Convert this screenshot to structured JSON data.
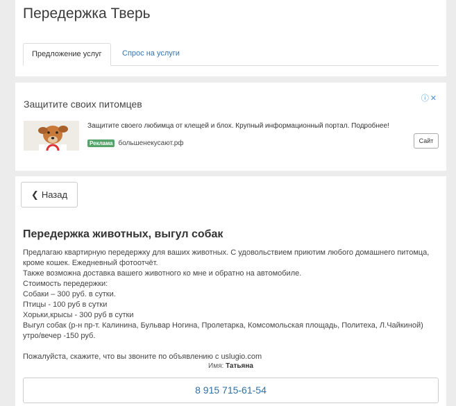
{
  "header": {
    "title": "Передержка Тверь",
    "tabs": [
      {
        "label": "Предложение услуг"
      },
      {
        "label": "Спрос на услуги"
      }
    ]
  },
  "ad": {
    "title": "Защитите своих питомцев",
    "text": "Защитите своего любимца от клещей и блох. Крупный информационный портал. Подробнее!",
    "badge": "Реклама",
    "domain": "большенекусают.рф",
    "button": "Сайт",
    "icons": [
      "info-icon",
      "close-icon"
    ]
  },
  "listing": {
    "back_label": "Назад",
    "title": "Передержка животных, выгул собак",
    "lines": [
      "Предлагаю квартирную передержку для ваших животных. С удовольствием приютим любого домашнего питомца,",
      "кроме кошек. Ежедневный фотоотчёт.",
      "Также возможна доставка вашего животного ко мне и обратно на автомобиле.",
      "Стоимость передержки:",
      "Собаки – 300 руб. в сутки.",
      "Птицы - 100 руб в сутки",
      "Хорьки,крысы - 300 руб в сутки",
      "Выгул собак (р-н пр-т. Калинина, Бульвар Ногина, Пролетарка, Комсомольская площадь, Политеха, Л.Чайкиной)",
      "утро/вечер -150 руб.",
      "",
      "Пожалуйста, скажите, что вы звоните по объявлению с uslugio.com"
    ],
    "name_label": "Имя:",
    "name_value": "Татьяна",
    "phone": "8 915 715-61-54"
  },
  "colors": {
    "link": "#2f74b5",
    "ad_badge": "#56a36a",
    "background": "#ececec"
  }
}
